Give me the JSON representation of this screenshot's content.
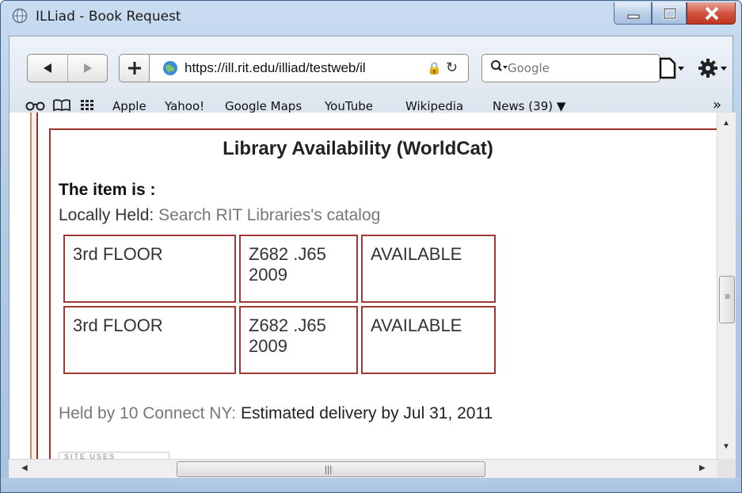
{
  "window": {
    "title": "ILLiad - Book Request",
    "icon": "browser-globe-icon"
  },
  "toolbar": {
    "url": "https://ill.rit.edu/illiad/testweb/il",
    "search_placeholder": "Google",
    "add_label": "+"
  },
  "bookmarks": [
    {
      "label": "Apple"
    },
    {
      "label": "Yahoo!"
    },
    {
      "label": "Google Maps"
    },
    {
      "label": "YouTube"
    },
    {
      "label": "Wikipedia"
    },
    {
      "label": "News (39) ▼"
    }
  ],
  "page": {
    "heading": "Library Availability (WorldCat)",
    "item_is": "The item is :",
    "locally_held_label": "Locally Held:",
    "locally_held_link": "Search RIT Libraries's catalog",
    "holdings": [
      {
        "location": "3rd FLOOR",
        "call_number": "Z682 .J65 2009",
        "status": "AVAILABLE"
      },
      {
        "location": "3rd FLOOR",
        "call_number": "Z682 .J65 2009",
        "status": "AVAILABLE"
      }
    ],
    "held_by_link": "Held by 10 Connect NY:",
    "held_by_delivery": "Estimated delivery by Jul 31, 2011",
    "site_uses": "SITE USES"
  },
  "colors": {
    "frame_border": "#a0302c",
    "link_gray": "#777777",
    "chrome_blue": "#b4cce6"
  }
}
